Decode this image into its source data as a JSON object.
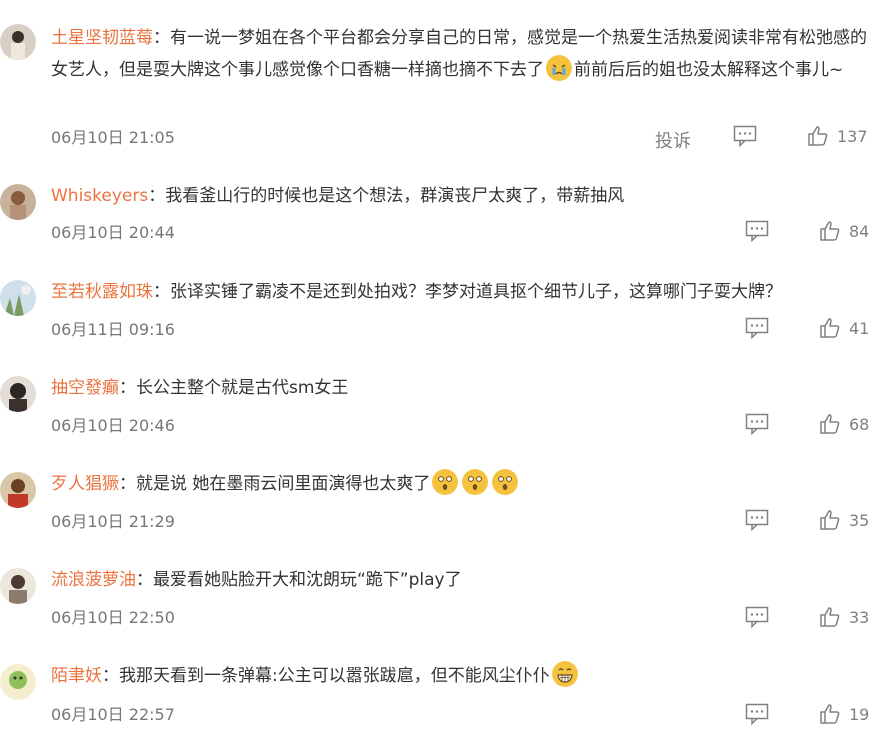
{
  "comments": [
    {
      "username": "土星坚韧蓝莓",
      "text_parts": [
        "有一说一梦姐在各个平台都会分享自己的日常，感觉是一个热爱生活热爱阅读非常有松弛感的女艺人，但是耍大牌这个事儿感觉像个口香糖一样摘也摘不下去了",
        "前前后后的姐也没太解释这个事儿~"
      ],
      "emojis": [
        "crying-emoji"
      ],
      "time": "06月10日 21:05",
      "report_label": "投诉",
      "likes": "137"
    },
    {
      "username": "Whiskeyers",
      "text": "我看釜山行的时候也是这个想法，群演丧尸太爽了，带薪抽风",
      "time": "06月10日 20:44",
      "likes": "84"
    },
    {
      "username": "至若秋露如珠",
      "text": "张译实锤了霸凌不是还到处拍戏？李梦对道具抠个细节儿子，这算哪门子耍大牌？",
      "time": "06月11日 09:16",
      "likes": "41"
    },
    {
      "username": "抽空發癲",
      "text": "长公主整个就是古代sm女王",
      "time": "06月10日 20:46",
      "likes": "68"
    },
    {
      "username": "歹人猖獗",
      "text": "就是说 她在墨雨云间里面演得也太爽了",
      "emojis": [
        "shocked-emoji",
        "shocked-emoji",
        "shocked-emoji"
      ],
      "time": "06月10日 21:29",
      "likes": "35"
    },
    {
      "username": "流浪菠萝油",
      "text": "最爱看她贴脸开大和沈朗玩“跪下”play了",
      "time": "06月10日 22:50",
      "likes": "33"
    },
    {
      "username": "陌聿妖",
      "text": "我那天看到一条弹幕:公主可以嚣张跋扈，但不能风尘仆仆",
      "emojis": [
        "grinning-emoji"
      ],
      "time": "06月10日 22:57",
      "likes": "19"
    }
  ],
  "separator": "：",
  "colors": {
    "username": "#eb7340",
    "text": "#333333",
    "meta": "#777777",
    "icon": "#808080"
  }
}
